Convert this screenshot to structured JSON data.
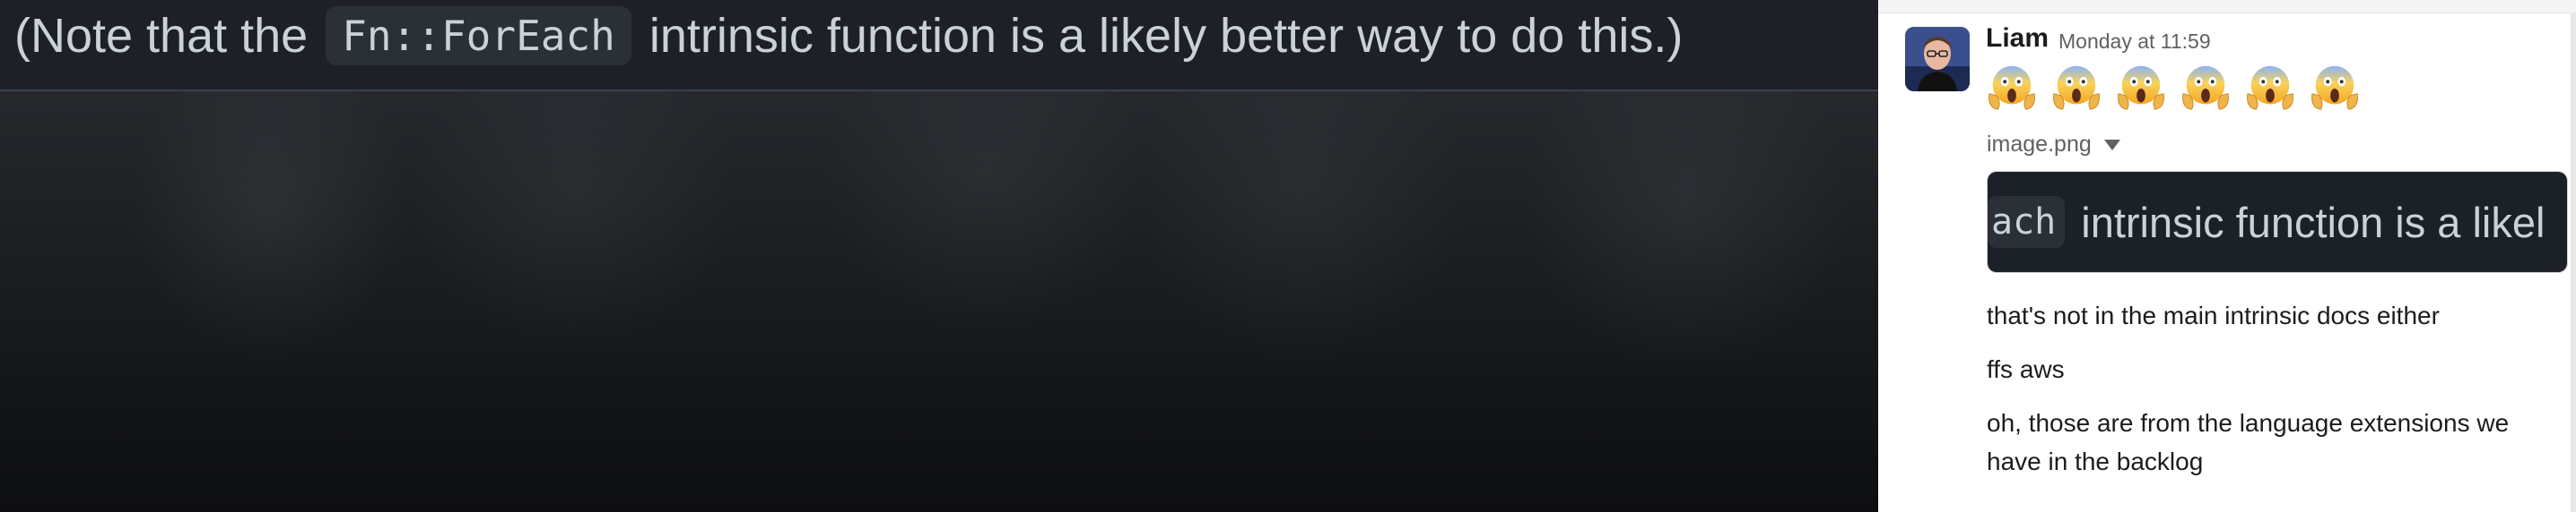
{
  "dark_pane": {
    "note_prefix": "(Note that the",
    "note_code": "Fn::ForEach",
    "note_suffix": "intrinsic function is a likely better way to do this.)"
  },
  "slack": {
    "author": "Liam",
    "timestamp": "Monday at 11:59",
    "reaction_emoji": [
      "😱",
      "😱",
      "😱",
      "😱",
      "😱",
      "😱"
    ],
    "attachment": {
      "file_name": "image.png",
      "preview_code": "ach",
      "preview_text": "intrinsic function is a likel"
    },
    "messages": [
      "that's not in the main intrinsic docs either",
      "ffs aws",
      "oh, those are from the language extensions we have in the backlog"
    ]
  },
  "colors": {
    "dark_bg": "#16181c",
    "code_chip_bg": "#2b3037",
    "text_light": "#c9d1d9",
    "slack_bg": "#ffffff",
    "slack_text": "#1d1c1d",
    "slack_muted": "#616061"
  },
  "icons": {
    "avatar": "user-avatar",
    "emoji": "face-screaming-in-fear-icon",
    "caret": "caret-down-icon"
  }
}
